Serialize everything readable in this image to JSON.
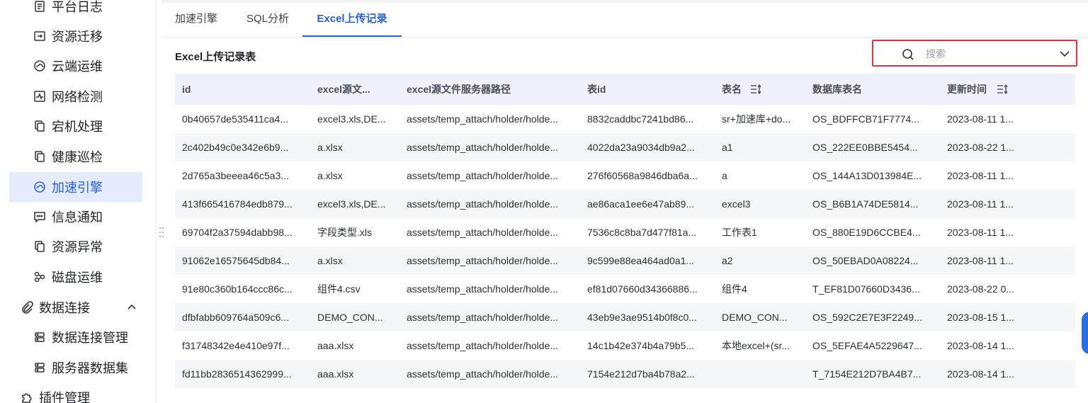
{
  "sidebar": {
    "items": [
      {
        "label": "平台日志",
        "icon": "log-icon",
        "type": "child"
      },
      {
        "label": "资源迁移",
        "icon": "migrate-icon",
        "type": "child"
      },
      {
        "label": "云端运维",
        "icon": "cloud-icon",
        "type": "child"
      },
      {
        "label": "网络检测",
        "icon": "network-check-icon",
        "type": "child"
      },
      {
        "label": "宕机处理",
        "icon": "copy-icon",
        "type": "child"
      },
      {
        "label": "健康巡检",
        "icon": "copy-icon",
        "type": "child"
      },
      {
        "label": "加速引擎",
        "icon": "cloud-icon",
        "type": "child",
        "active": true
      },
      {
        "label": "信息通知",
        "icon": "message-icon",
        "type": "child"
      },
      {
        "label": "资源异常",
        "icon": "copy-icon",
        "type": "child"
      },
      {
        "label": "磁盘运维",
        "icon": "share-icon",
        "type": "child"
      },
      {
        "label": "数据连接",
        "icon": "paperclip-icon",
        "type": "group"
      },
      {
        "label": "数据连接管理",
        "icon": "server-icon",
        "type": "child"
      },
      {
        "label": "服务器数据集",
        "icon": "server-icon",
        "type": "child"
      },
      {
        "label": "插件管理",
        "icon": "puzzle-icon",
        "type": "group"
      }
    ]
  },
  "tabs": [
    {
      "label": "加速引擎"
    },
    {
      "label": "SQL分析"
    },
    {
      "label": "Excel上传记录",
      "active": true
    }
  ],
  "section_title": "Excel上传记录表",
  "search": {
    "placeholder": "搜索",
    "value": ""
  },
  "table": {
    "columns": [
      "id",
      "excel源文...",
      "excel源文件服务器路径",
      "表id",
      "表名",
      "数据库表名",
      "更新时间"
    ],
    "rows": [
      [
        "0b40657de535411ca4...",
        "excel3.xls,DE...",
        "assets/temp_attach/holder/holde...",
        "8832caddbc7241bd86...",
        "sr+加速库+do...",
        "OS_BDFFCB71F7774...",
        "2023-08-11 1..."
      ],
      [
        "2c402b49c0e342e6b9...",
        "a.xlsx",
        "assets/temp_attach/holder/holde...",
        "4022da23a9034db9a2...",
        "a1",
        "OS_222EE0BBE5454...",
        "2023-08-22 1..."
      ],
      [
        "2d765a3beeea46c5a3...",
        "a.xlsx",
        "assets/temp_attach/holder/holde...",
        "276f60568a9846dba6a...",
        "a",
        "OS_144A13D013984E...",
        "2023-08-11 1..."
      ],
      [
        "413f665416784edb879...",
        "excel3.xls,DE...",
        "assets/temp_attach/holder/holde...",
        "ae86aca1ee6e47ab89...",
        "excel3",
        "OS_B6B1A74DE5814...",
        "2023-08-11 1..."
      ],
      [
        "69704f2a37594dabb98...",
        "字段类型.xls",
        "assets/temp_attach/holder/holde...",
        "7536c8c8ba7d477f81a...",
        "工作表1",
        "OS_880E19D6CCBE4...",
        "2023-08-11 1..."
      ],
      [
        "91062e16575645db84...",
        "a.xlsx",
        "assets/temp_attach/holder/holde...",
        "9c599e88ea464ad0a1...",
        "a2",
        "OS_50EBAD0A08224...",
        "2023-08-11 1..."
      ],
      [
        "91e80c360b164ccc86c...",
        "组件4.csv",
        "assets/temp_attach/holder/holde...",
        "ef81d07660d34366886...",
        "组件4",
        "T_EF81D07660D3436...",
        "2023-08-22 0..."
      ],
      [
        "dfbfabb609764a509c6...",
        "DEMO_CON...",
        "assets/temp_attach/holder/holde...",
        "43eb9e3ae9514b0f8c0...",
        "DEMO_CON...",
        "OS_592C2E7E3F2249...",
        "2023-08-15 1..."
      ],
      [
        "f31748342e4e410e97f...",
        "aaa.xlsx",
        "assets/temp_attach/holder/holde...",
        "14c1b42e374b4a79b5...",
        "本地excel+(sr...",
        "OS_5EFAE4A5229647...",
        "2023-08-14 1..."
      ],
      [
        "fd11bb2836514362999...",
        "aaa.xlsx",
        "assets/temp_attach/holder/holde...",
        "7154e212d7ba4b78a2...",
        "",
        "T_7154E212D7BA4B7...",
        "2023-08-14 1..."
      ]
    ]
  },
  "colors": {
    "accent": "#2a5fd6",
    "active_bg": "#e4ebfb",
    "search_border": "#d9363e",
    "header_bg": "#eef1f7"
  }
}
